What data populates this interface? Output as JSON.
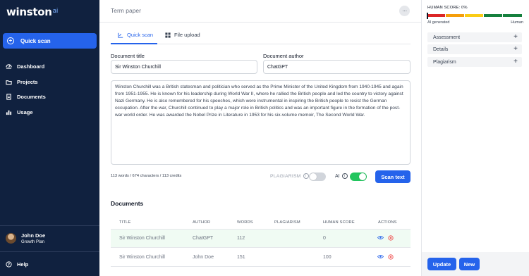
{
  "sidebar": {
    "logo": "winston",
    "logo_suffix": "ai",
    "quick_scan": "Quick scan",
    "items": [
      {
        "label": "Dashboard",
        "icon": "dashboard-icon"
      },
      {
        "label": "Projects",
        "icon": "projects-icon"
      },
      {
        "label": "Documents",
        "icon": "documents-icon"
      },
      {
        "label": "Usage",
        "icon": "usage-icon"
      }
    ],
    "user": {
      "name": "John Doe",
      "plan": "Growth Plan"
    },
    "help": "Help"
  },
  "header": {
    "title": "Term paper",
    "more": "···"
  },
  "tabs": [
    {
      "label": "Quick scan",
      "icon": "quick-scan-icon",
      "active": true
    },
    {
      "label": "File upload",
      "icon": "file-upload-icon",
      "active": false
    }
  ],
  "form": {
    "title_label": "Document title",
    "title_value": "Sir Winston Churchill",
    "author_label": "Document author",
    "author_value": "ChatGPT",
    "text": "Winston Churchill was a British statesman and politician who served as the Prime Minister of the United Kingdom from 1940-1945 and again from 1951-1955. He is known for his leadership during World War II, where he rallied the British people and led the country to victory against Nazi Germany. He is also remembered for his speeches, which were instrumental in inspiring the British people to resist the German occupation. After the war, Churchill continued to play a major role in British politics and was an important figure in the formation of the post-war world order. He was awarded the Nobel Prize in Literature in 1953 for his six-volume memoir, The Second World War.",
    "counts": "113 words / 674 characters / 113 credits",
    "plagiarism_label": "PLAGIARISM",
    "plagiarism_on": false,
    "ai_label": "AI",
    "ai_on": true,
    "scan_button": "Scan text"
  },
  "documents": {
    "title": "Documents",
    "columns": [
      "TITLE",
      "AUTHOR",
      "WORDS",
      "PLAGIARISM",
      "HUMAN SCORE",
      "ACTIONS"
    ],
    "rows": [
      {
        "title": "Sir Winston Churchill",
        "author": "ChatGPT",
        "words": "112",
        "plagiarism": "",
        "human_score": "0"
      },
      {
        "title": "Sir Winston Churchill",
        "author": "John Doe",
        "words": "151",
        "plagiarism": "",
        "human_score": "100"
      }
    ]
  },
  "panel": {
    "human_score": "HUMAN SCORE: 0%",
    "human_score_value": 0,
    "scale_colors": [
      "#dc2626",
      "#f59e0b",
      "#facc15",
      "#15803d",
      "#15803d"
    ],
    "scale_left": "AI generated",
    "scale_right": "Human",
    "sections": [
      {
        "label": "Assessment",
        "icon": "plus-icon"
      },
      {
        "label": "Details",
        "icon": "plus-icon"
      },
      {
        "label": "Plagiarism",
        "icon": "plus-icon"
      }
    ],
    "update_button": "Update",
    "new_button": "New"
  },
  "colors": {
    "accent": "#2563eb",
    "sidebar": "#10213f",
    "toggle_on": "#22c55e"
  }
}
